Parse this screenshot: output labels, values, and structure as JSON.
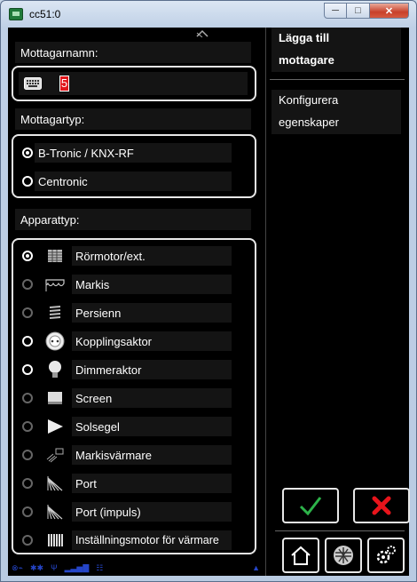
{
  "window": {
    "title": "cc51:0"
  },
  "receiver_name": {
    "label": "Mottagarnamn:",
    "value": "5"
  },
  "receiver_type": {
    "label": "Mottagartyp:",
    "options": [
      {
        "label": "B-Tronic / KNX-RF",
        "selected": true
      },
      {
        "label": "Centronic",
        "selected": false
      }
    ]
  },
  "device_type": {
    "label": "Apparattyp:",
    "items": [
      {
        "label": "Rörmotor/ext.",
        "icon": "tubular-motor-icon",
        "selected": true,
        "enabled": true
      },
      {
        "label": "Markis",
        "icon": "awning-icon",
        "selected": false,
        "enabled": false
      },
      {
        "label": "Persienn",
        "icon": "venetian-blind-icon",
        "selected": false,
        "enabled": false
      },
      {
        "label": "Kopplingsaktor",
        "icon": "socket-icon",
        "selected": false,
        "enabled": true
      },
      {
        "label": "Dimmeraktor",
        "icon": "bulb-icon",
        "selected": false,
        "enabled": true
      },
      {
        "label": "Screen",
        "icon": "screen-icon",
        "selected": false,
        "enabled": false
      },
      {
        "label": "Solsegel",
        "icon": "sun-sail-icon",
        "selected": false,
        "enabled": false
      },
      {
        "label": "Markisvärmare",
        "icon": "heater-icon",
        "selected": false,
        "enabled": false
      },
      {
        "label": "Port",
        "icon": "garage-door-icon",
        "selected": false,
        "enabled": false
      },
      {
        "label": "Port (impuls)",
        "icon": "garage-door-icon",
        "selected": false,
        "enabled": false
      },
      {
        "label": "Inställningsmotor för värmare",
        "icon": "radiator-icon",
        "selected": false,
        "enabled": false
      }
    ]
  },
  "right_panel": {
    "title_line1": "Lägga till",
    "title_line2": "mottagare",
    "sub_line1": "Konfigurera",
    "sub_line2": "egenskaper"
  },
  "colors": {
    "confirm": "#2db34a",
    "cancel": "#e8141b",
    "status": "#2545c8"
  }
}
